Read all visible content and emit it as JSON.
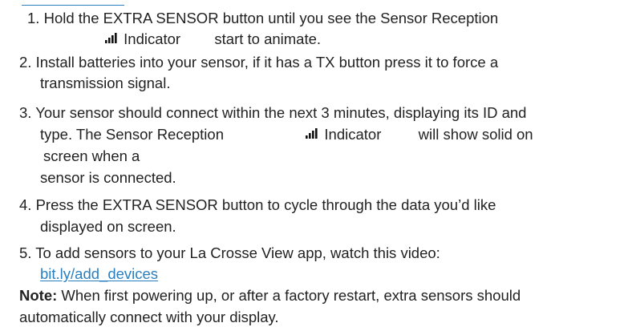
{
  "steps": [
    {
      "number": "1.",
      "lines": [
        "Hold the EXTRA SENSOR button until you see the Sensor Reception",
        "Indicator",
        "start to animate."
      ]
    },
    {
      "number": "2.",
      "lines": [
        "Install batteries into your sensor, if it has a TX button press it to force a",
        "transmission signal."
      ]
    },
    {
      "number": "3.",
      "lines": [
        "Your sensor should connect within the next 3 minutes, displaying its ID and",
        "type. The Sensor Reception",
        "Indicator",
        "will show solid on",
        "screen when a",
        "sensor is connected."
      ]
    },
    {
      "number": "4.",
      "lines": [
        "Press the EXTRA SENSOR button to cycle through the data you’d like",
        "displayed on screen."
      ]
    },
    {
      "number": "5.",
      "lines": [
        "To add sensors to your La Crosse View app, watch this video:"
      ],
      "link": "bit.ly/add_devices"
    }
  ],
  "note": {
    "label": "Note:",
    "text_line1": "When first powering up, or after a factory restart, extra sensors should",
    "text_line2": "automatically connect with your display."
  },
  "icons": {
    "signal": "signal-strength-icon"
  },
  "colors": {
    "text": "#222222",
    "link": "#2a7fc0"
  }
}
